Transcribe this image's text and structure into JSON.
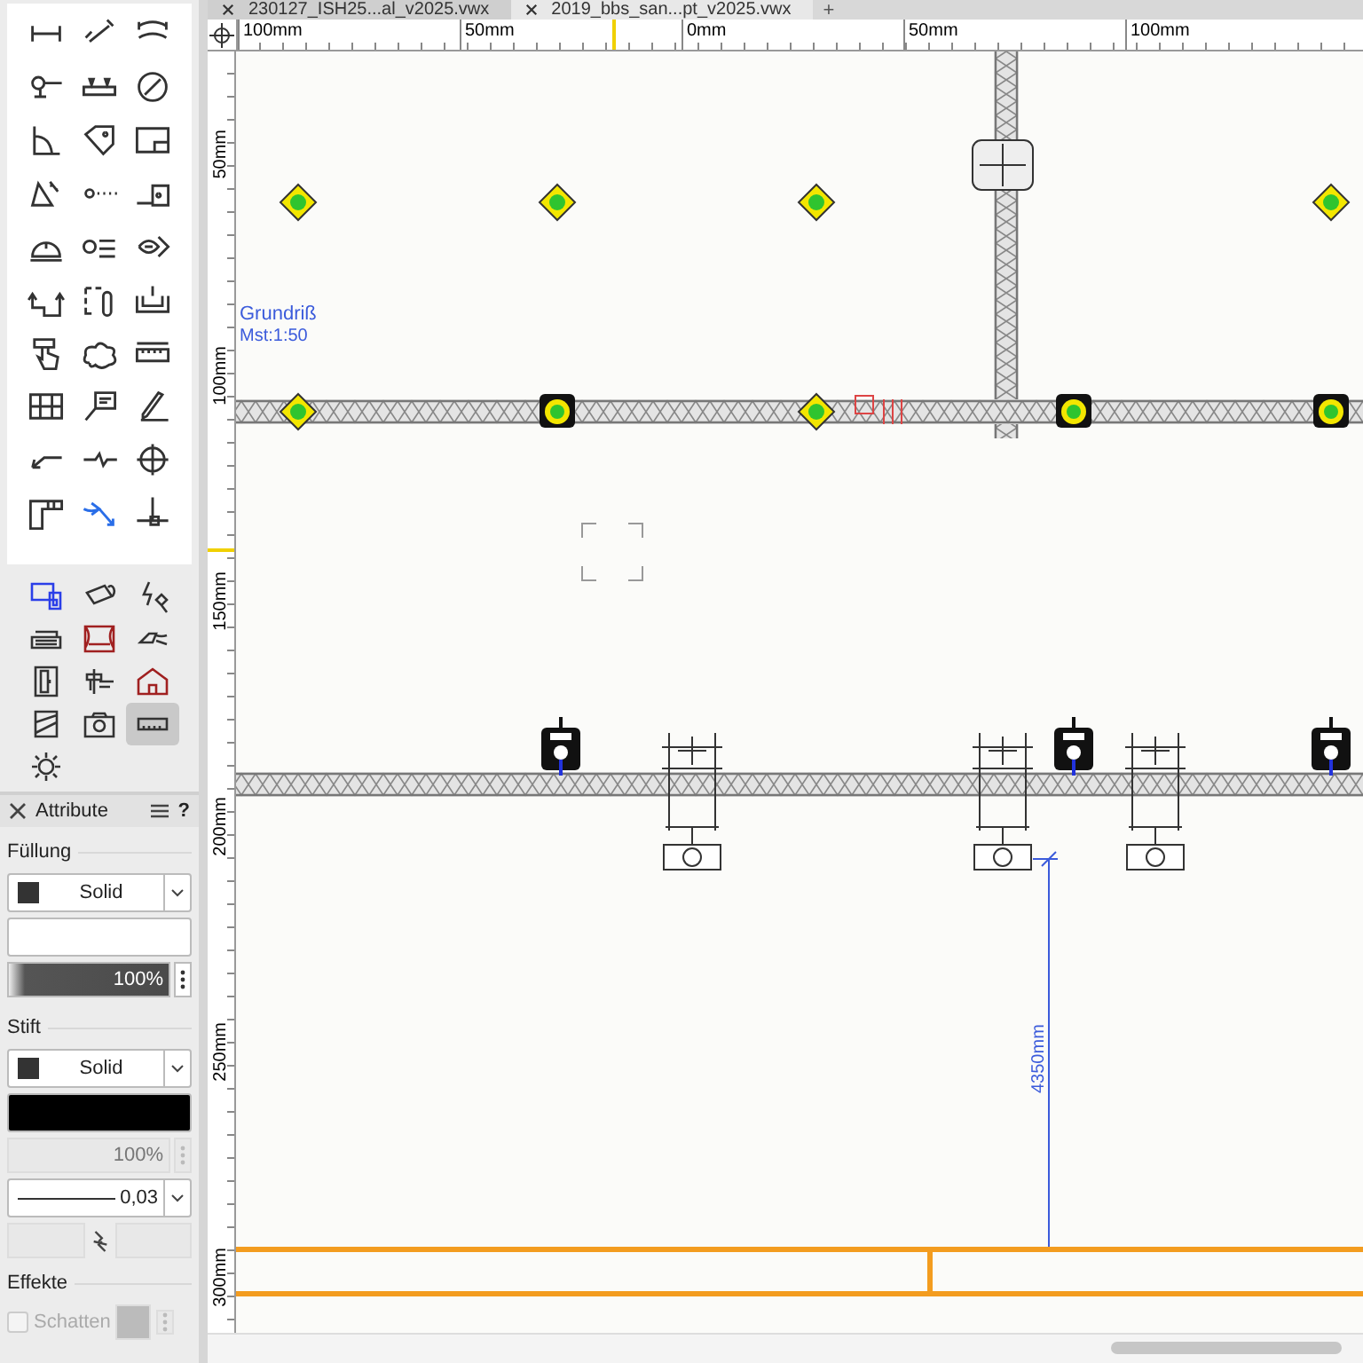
{
  "tabs": [
    {
      "label": "230127_ISH25...al_v2025.vwx",
      "selected": false
    },
    {
      "label": "2019_bbs_san...pt_v2025.vwx",
      "selected": true
    }
  ],
  "add_tab": "+",
  "ruler_top": [
    "100mm",
    "50mm",
    "0mm",
    "50mm",
    "100mm"
  ],
  "ruler_left": [
    "50mm",
    "100mm",
    "150mm",
    "200mm",
    "250mm",
    "300mm"
  ],
  "drawing": {
    "layer_label": "Grundriß",
    "scale_label": "Mst:1:50",
    "dimension": "4350mm"
  },
  "tool_palette": {
    "tools": [
      {
        "selected": false
      },
      {
        "selected": false
      },
      {
        "selected": false
      },
      {
        "selected": false
      },
      {
        "selected": false
      },
      {
        "selected": false
      },
      {
        "selected": false
      },
      {
        "selected": false
      },
      {
        "selected": false
      },
      {
        "selected": false
      },
      {
        "selected": false
      },
      {
        "selected": false
      },
      {
        "selected": false
      },
      {
        "selected": false
      },
      {
        "selected": false
      },
      {
        "selected": false
      },
      {
        "selected": false
      },
      {
        "selected": false
      },
      {
        "selected": false
      },
      {
        "selected": false
      },
      {
        "selected": false
      },
      {
        "selected": false
      },
      {
        "selected": false
      },
      {
        "selected": false
      },
      {
        "selected": false
      },
      {
        "selected": false
      },
      {
        "selected": false
      },
      {
        "selected": false
      },
      {
        "selected": false
      },
      {
        "selected": false
      }
    ]
  },
  "object_palette": {
    "tools": [
      {
        "selected": false
      },
      {
        "selected": false
      },
      {
        "selected": false
      },
      {
        "selected": false
      },
      {
        "selected": false
      },
      {
        "selected": false
      },
      {
        "selected": false
      },
      {
        "selected": false
      },
      {
        "selected": false
      },
      {
        "selected": false
      },
      {
        "selected": false
      },
      {
        "selected": true
      },
      {
        "selected": false
      }
    ]
  },
  "attributes": {
    "title": "Attribute",
    "help": "?",
    "fill": {
      "heading": "Füllung",
      "style": "Solid",
      "opacity": "100%",
      "level": 1
    },
    "pen": {
      "heading": "Stift",
      "style": "Solid",
      "opacity": "100%",
      "opacity_disabled": true,
      "thickness": "0,03"
    },
    "effects": {
      "heading": "Effekte",
      "shadow": {
        "label": "Schatten",
        "checked": false,
        "disabled": true
      }
    }
  }
}
